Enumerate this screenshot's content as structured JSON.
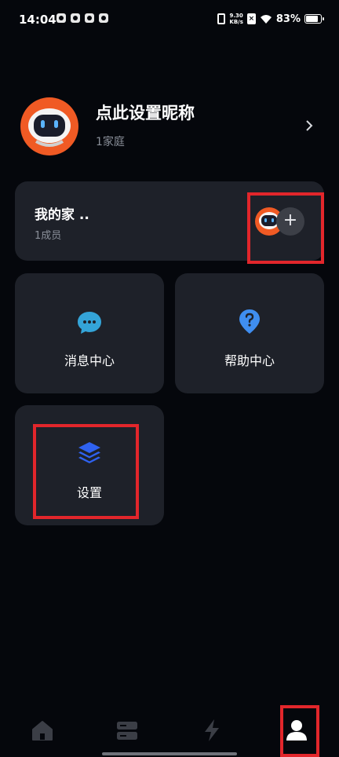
{
  "status_bar": {
    "time": "14:04",
    "network_speed_value": "9.30",
    "network_speed_unit": "KB/s",
    "battery": "83%"
  },
  "profile": {
    "nickname": "点此设置昵称",
    "family_count": "1家庭"
  },
  "home_card": {
    "name": "我的家 ..",
    "members": "1成员",
    "add_symbol": "+"
  },
  "tiles": {
    "messages": "消息中心",
    "help": "帮助中心",
    "settings": "设置"
  },
  "colors": {
    "background": "#05070c",
    "card": "#1e2129",
    "highlight": "#e2262b",
    "message_icon": "#34a4d8",
    "help_icon": "#3f8ef0",
    "settings_icon": "#2f62f0",
    "avatar_orange": "#f05a24"
  },
  "icons": {
    "nav": [
      "home-icon",
      "devices-icon",
      "scene-icon",
      "profile-icon"
    ]
  }
}
